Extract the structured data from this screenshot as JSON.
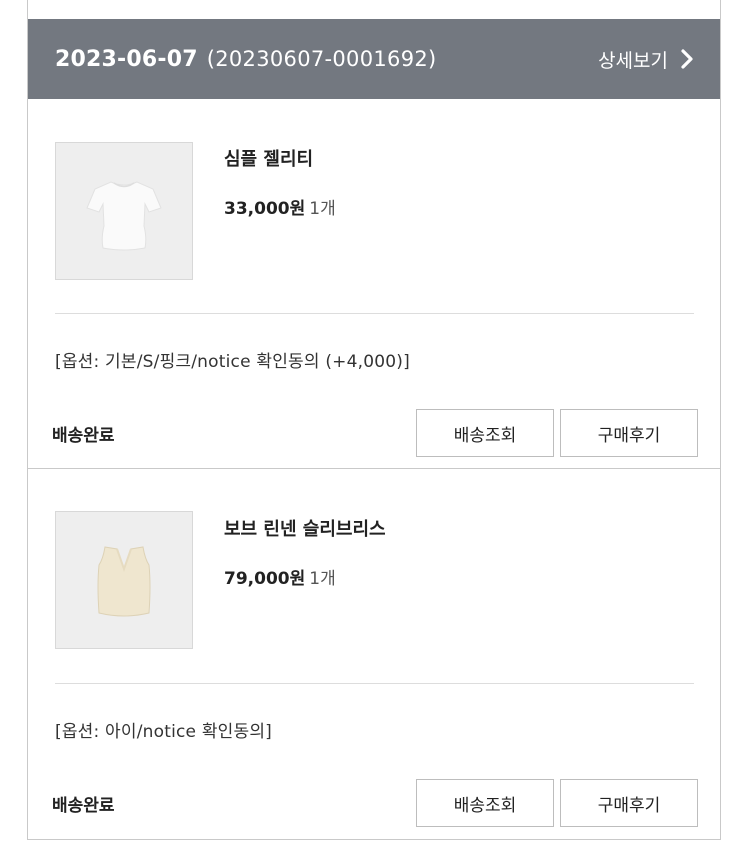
{
  "order": {
    "date": "2023-06-07",
    "number": "(20230607-0001692)",
    "detail_label": "상세보기"
  },
  "items": [
    {
      "name": "심플 젤리티",
      "price": "33,000원",
      "qty": "1개",
      "option": "[옵션: 기본/S/핑크/notice 확인동의 (+4,000)]",
      "status": "배송완료",
      "track_label": "배송조회",
      "review_label": "구매후기",
      "thumb_icon": "white-tshirt-icon"
    },
    {
      "name": "보브 린넨 슬리브리스",
      "price": "79,000원",
      "qty": "1개",
      "option": "[옵션: 아이/notice 확인동의]",
      "status": "배송완료",
      "track_label": "배송조회",
      "review_label": "구매후기",
      "thumb_icon": "beige-vest-icon"
    }
  ],
  "colors": {
    "header_bg": "#737880",
    "border": "#c9c9c9"
  }
}
